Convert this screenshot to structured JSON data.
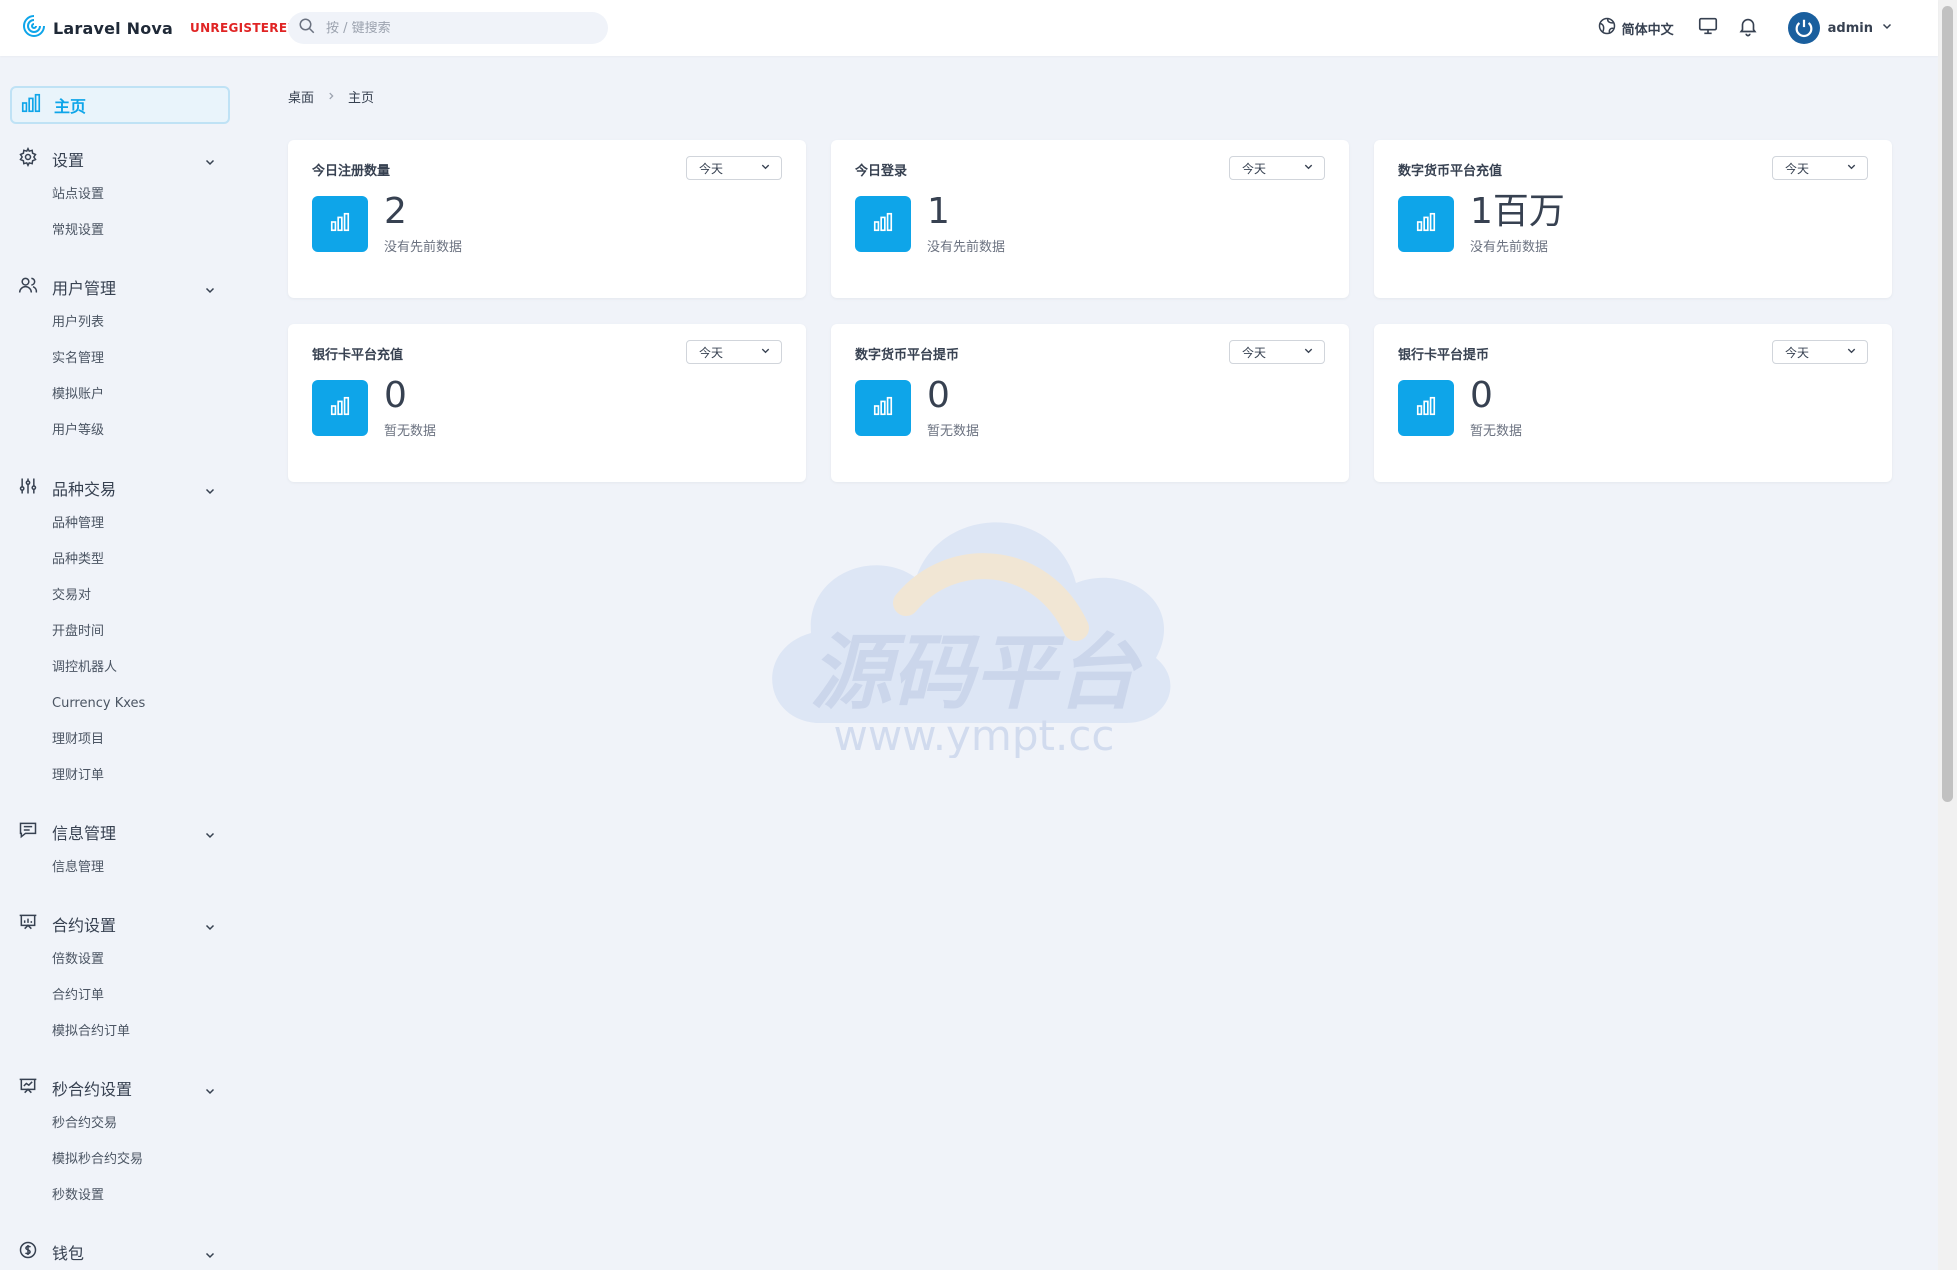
{
  "header": {
    "brand": "Laravel Nova",
    "brand_tag": "UNREGISTERED",
    "search_placeholder": "按 / 键搜索",
    "language": "简体中文",
    "user": "admin"
  },
  "sidebar": {
    "home": "主页",
    "groups": [
      {
        "label": "设置",
        "icon": "gear-icon",
        "items": [
          "站点设置",
          "常规设置"
        ]
      },
      {
        "label": "用户管理",
        "icon": "users-icon",
        "items": [
          "用户列表",
          "实名管理",
          "模拟账户",
          "用户等级"
        ]
      },
      {
        "label": "品种交易",
        "icon": "sliders-icon",
        "items": [
          "品种管理",
          "品种类型",
          "交易对",
          "开盘时间",
          "调控机器人",
          "Currency Kxes",
          "理财项目",
          "理财订单"
        ]
      },
      {
        "label": "信息管理",
        "icon": "chat-icon",
        "items": [
          "信息管理"
        ]
      },
      {
        "label": "合约设置",
        "icon": "presentation-chart-icon",
        "items": [
          "倍数设置",
          "合约订单",
          "模拟合约订单"
        ]
      },
      {
        "label": "秒合约设置",
        "icon": "presentation-chart-line-icon",
        "items": [
          "秒合约交易",
          "模拟秒合约交易",
          "秒数设置"
        ]
      },
      {
        "label": "钱包",
        "icon": "dollar-circle-icon",
        "items": []
      }
    ]
  },
  "breadcrumb": [
    "桌面",
    "主页"
  ],
  "cards": [
    {
      "title": "今日注册数量",
      "range": "今天",
      "value": "2",
      "note": "没有先前数据"
    },
    {
      "title": "今日登录",
      "range": "今天",
      "value": "1",
      "note": "没有先前数据"
    },
    {
      "title": "数字货币平台充值",
      "range": "今天",
      "value": "1百万",
      "note": "没有先前数据"
    },
    {
      "title": "银行卡平台充值",
      "range": "今天",
      "value": "0",
      "note": "暂无数据"
    },
    {
      "title": "数字货币平台提币",
      "range": "今天",
      "value": "0",
      "note": "暂无数据"
    },
    {
      "title": "银行卡平台提币",
      "range": "今天",
      "value": "0",
      "note": "暂无数据"
    }
  ],
  "watermark": {
    "title": "源码平台",
    "url": "www.ympt.cc"
  },
  "colors": {
    "accent": "#0ea5e9",
    "danger": "#e02424",
    "bg": "#f0f3f9"
  }
}
